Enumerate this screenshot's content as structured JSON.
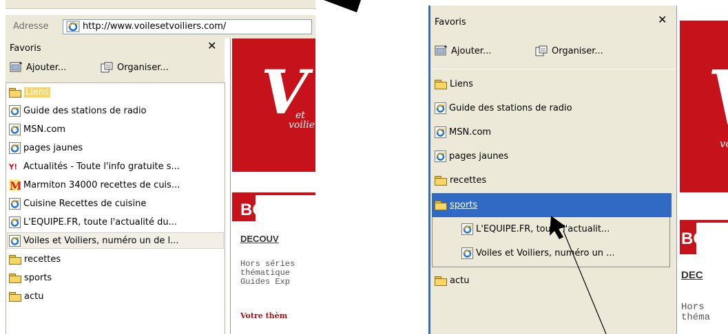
{
  "left": {
    "address_label": "Adresse",
    "url": "http://www.voilesetvoiliers.com/",
    "favorites_title": "Favoris",
    "close": "✕",
    "add_label": "Ajouter...",
    "organize_label": "Organiser...",
    "items": [
      {
        "label": "Liens",
        "icon": "folder-icon"
      },
      {
        "label": "Guide des stations de radio",
        "icon": "ie-page-icon"
      },
      {
        "label": "MSN.com",
        "icon": "ie-page-icon"
      },
      {
        "label": "pages jaunes",
        "icon": "ie-page-icon"
      },
      {
        "label": "Actualités - Toute l'info gratuite s...",
        "icon": "yahoo-icon"
      },
      {
        "label": "Marmiton  34000 recettes de cuis...",
        "icon": "marmiton-icon"
      },
      {
        "label": "Cuisine  Recettes de cuisine",
        "icon": "ie-page-icon"
      },
      {
        "label": "L'EQUIPE.FR, toute l'actualité du...",
        "icon": "ie-page-icon"
      },
      {
        "label": "Voiles et Voiliers, numéro un de l...",
        "icon": "ie-page-icon"
      },
      {
        "label": "recettes",
        "icon": "folder-icon"
      },
      {
        "label": "sports",
        "icon": "folder-icon"
      },
      {
        "label": "actu",
        "icon": "folder-icon"
      }
    ],
    "site": {
      "logo": "V",
      "logo_et": "et",
      "logo_sub": "voilier",
      "shop_heading": "BOUTI",
      "discover": "DECOUV",
      "desc_lines": [
        "Hors séries",
        "thématique",
        "Guides Exp"
      ],
      "cta": "Votre thèm"
    }
  },
  "right": {
    "favorites_title": "Favoris",
    "close": "✕",
    "add_label": "Ajouter...",
    "organize_label": "Organiser...",
    "items": [
      {
        "label": "Liens",
        "icon": "folder-icon"
      },
      {
        "label": "Guide des stations de radio",
        "icon": "ie-page-icon"
      },
      {
        "label": "MSN.com",
        "icon": "ie-page-icon"
      },
      {
        "label": "pages jaunes",
        "icon": "ie-page-icon"
      },
      {
        "label": "recettes",
        "icon": "folder-icon"
      },
      {
        "label": "sports",
        "icon": "folder-icon"
      }
    ],
    "sub_items": [
      {
        "label": "L'EQUIPE.FR, toute l'actualit...",
        "icon": "ie-page-icon"
      },
      {
        "label": "Voiles et Voiliers, numéro un ...",
        "icon": "ie-page-icon"
      }
    ],
    "last_item": {
      "label": "actu",
      "icon": "folder-icon"
    },
    "site": {
      "logo": "V",
      "logo_sub": "vo",
      "shop_heading": "BO",
      "discover": "DEC",
      "desc_lines": [
        "Hors",
        "théma"
      ]
    }
  },
  "colors": {
    "selection": "#316ac5",
    "brand_red": "#c6121a",
    "pane_bg": "#ece9d8"
  }
}
